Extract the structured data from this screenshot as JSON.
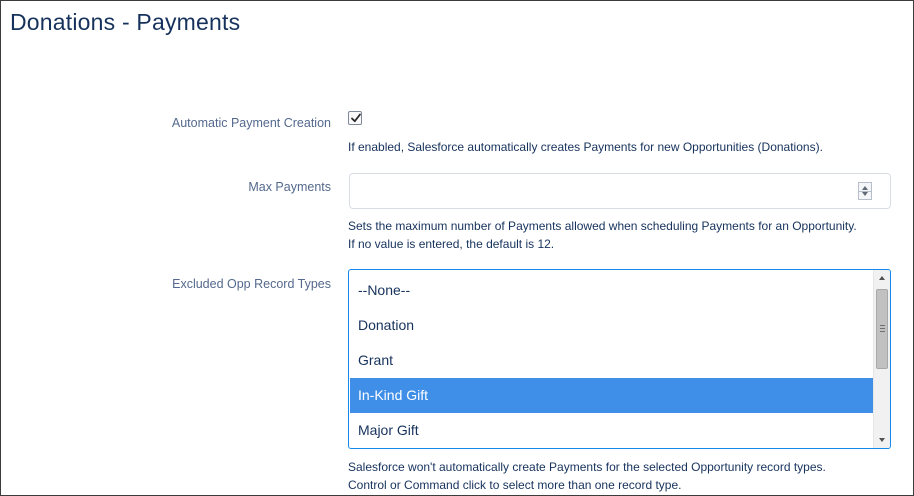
{
  "page": {
    "title": "Donations - Payments"
  },
  "fields": {
    "auto_payment": {
      "label": "Automatic Payment Creation",
      "checked": true,
      "help": "If enabled, Salesforce automatically creates Payments for new Opportunities (Donations)."
    },
    "max_payments": {
      "label": "Max Payments",
      "value": "",
      "help_line1": "Sets the maximum number of Payments allowed when scheduling Payments for an Opportunity.",
      "help_line2": "If no value is entered, the default is 12."
    },
    "excluded_types": {
      "label": "Excluded Opp Record Types",
      "options": [
        "--None--",
        "Donation",
        "Grant",
        "In-Kind Gift",
        "Major Gift"
      ],
      "selected": "In-Kind Gift",
      "help_line1": "Salesforce won't automatically create Payments for the selected Opportunity record types.",
      "help_line2": "Control or Command click to select more than one record type."
    }
  },
  "colors": {
    "title": "#16325c",
    "label": "#54698d",
    "focus_border": "#1589ee",
    "selected_option": "#3f8fe8"
  },
  "icons": {
    "checkbox": "checkmark-icon",
    "spinner": "spinner-arrows-icon",
    "scroll_up": "scroll-up-arrow-icon",
    "scroll_down": "scroll-down-arrow-icon"
  }
}
